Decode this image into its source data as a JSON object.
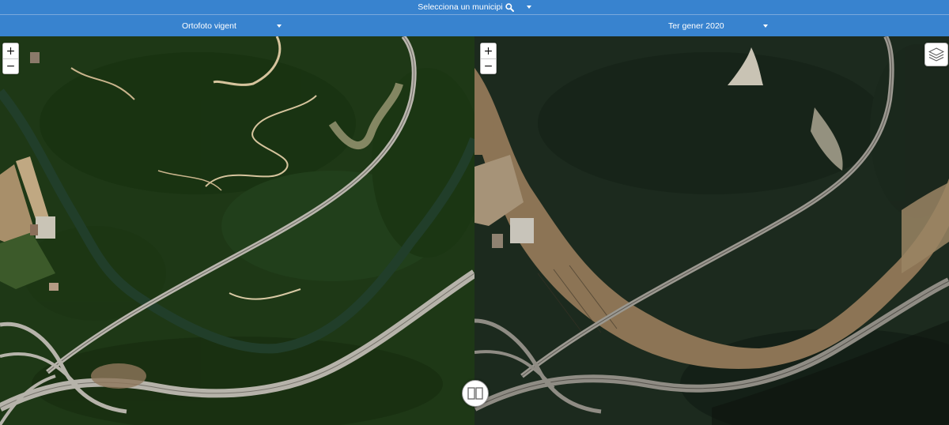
{
  "header": {
    "municipi_label": "Selecciona un municipi"
  },
  "left_panel": {
    "layer_label": "Ortofoto vigent"
  },
  "right_panel": {
    "layer_label": "Ter gener 2020"
  },
  "controls": {
    "zoom_in": "+",
    "zoom_out": "−",
    "icons": [
      "search-icon",
      "chevron-down-icon",
      "layers-icon",
      "compare-split-icon"
    ]
  },
  "colors": {
    "header": "#3883cf",
    "vegetation": "#1f3a16",
    "flood_water": "#8c7455",
    "road": "#b9b6ad"
  }
}
